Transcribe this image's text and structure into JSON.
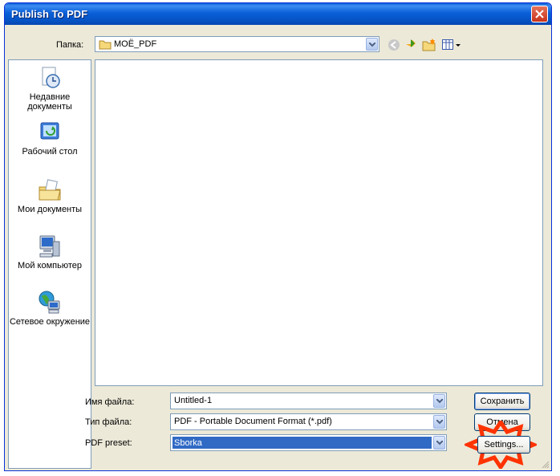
{
  "window": {
    "title": "Publish To PDF"
  },
  "folder": {
    "label": "Папка:",
    "value": "МОЁ_PDF"
  },
  "places": [
    {
      "label": "Недавние документы",
      "icon": "recent-documents-icon"
    },
    {
      "label": "Рабочий стол",
      "icon": "desktop-icon"
    },
    {
      "label": "Мои документы",
      "icon": "my-documents-icon"
    },
    {
      "label": "Мой компьютер",
      "icon": "my-computer-icon"
    },
    {
      "label": "Сетевое окружение",
      "icon": "network-icon"
    }
  ],
  "filename": {
    "label": "Имя файла:",
    "value": "Untitled-1"
  },
  "filetype": {
    "label": "Тип файла:",
    "value": "PDF - Portable Document Format (*.pdf)"
  },
  "preset": {
    "label": "PDF preset:",
    "value": "Sborka"
  },
  "buttons": {
    "save": "Сохранить",
    "cancel": "Отмена",
    "settings": "Settings..."
  },
  "colors": {
    "title_bar": "#0a5fd8",
    "highlight": "#ff3300",
    "selection": "#316ac5"
  }
}
